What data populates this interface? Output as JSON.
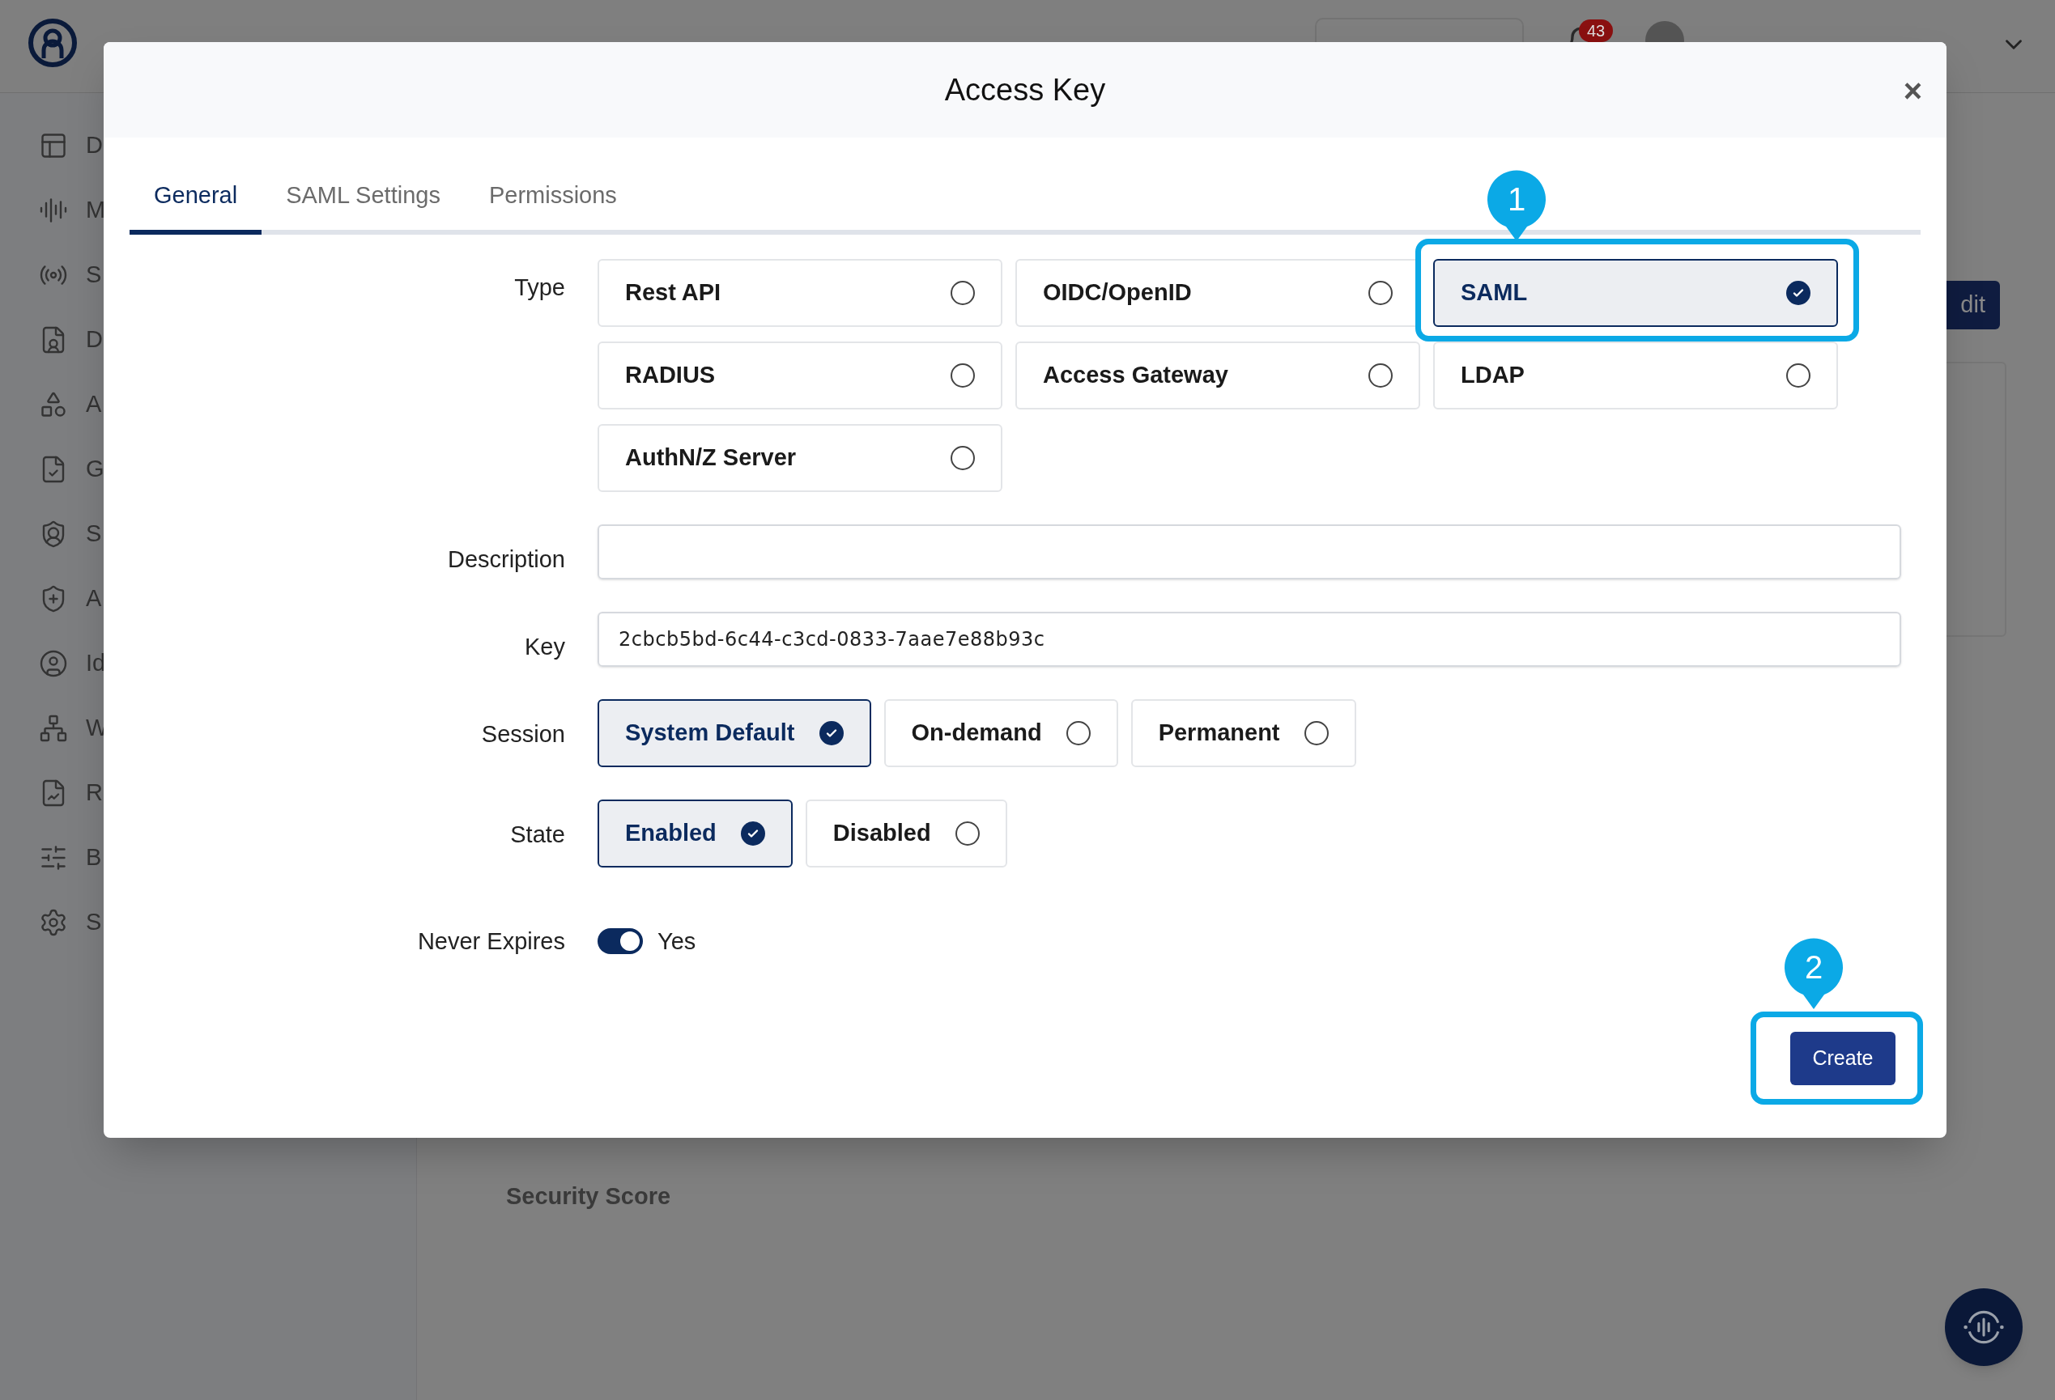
{
  "header": {
    "notifications": {
      "count": "43"
    }
  },
  "sidebar": {
    "items": [
      {
        "label": "D"
      },
      {
        "label": "M"
      },
      {
        "label": "S"
      },
      {
        "label": "D"
      },
      {
        "label": "A"
      },
      {
        "label": "G"
      },
      {
        "label": "S"
      },
      {
        "label": "A"
      },
      {
        "label": "Id"
      },
      {
        "label": "W"
      },
      {
        "label": "R"
      },
      {
        "label": "B"
      },
      {
        "label": "S"
      }
    ]
  },
  "background": {
    "edit_button": "dit",
    "section_title": "Security Score"
  },
  "dialog": {
    "title": "Access Key",
    "close": "×",
    "tabs": [
      {
        "label": "General",
        "selected": true
      },
      {
        "label": "SAML Settings",
        "selected": false
      },
      {
        "label": "Permissions",
        "selected": false
      }
    ],
    "fields": [
      {
        "kind": "grid",
        "label": "Type",
        "options": [
          {
            "label": "Rest API",
            "selected": false
          },
          {
            "label": "OIDC/OpenID",
            "selected": false
          },
          {
            "label": "SAML",
            "selected": true
          },
          {
            "label": "RADIUS",
            "selected": false
          },
          {
            "label": "Access Gateway",
            "selected": false
          },
          {
            "label": "LDAP",
            "selected": false
          },
          {
            "label": "AuthN/Z Server",
            "selected": false
          }
        ]
      },
      {
        "kind": "text",
        "label": "Description"
      },
      {
        "kind": "text",
        "label": "Key",
        "value": "2cbcb5bd-6c44-c3cd-0833-7aae7e88b93c"
      },
      {
        "kind": "inline",
        "label": "Session",
        "options": [
          {
            "label": "System Default",
            "selected": true
          },
          {
            "label": "On-demand",
            "selected": false
          },
          {
            "label": "Permanent",
            "selected": false
          }
        ]
      },
      {
        "kind": "inline",
        "label": "State",
        "options": [
          {
            "label": "Enabled",
            "selected": true
          },
          {
            "label": "Disabled",
            "selected": false
          }
        ]
      },
      {
        "kind": "toggle",
        "label": "Never Expires",
        "on": true,
        "text": "Yes"
      }
    ],
    "create_button": "Create"
  },
  "annotations": [
    {
      "number": "1"
    },
    {
      "number": "2"
    }
  ]
}
